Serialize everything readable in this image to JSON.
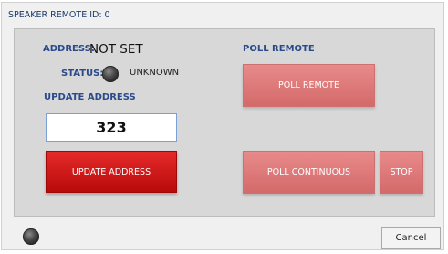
{
  "window": {
    "title": "SPEAKER REMOTE ID: 0"
  },
  "address": {
    "label": "ADDRESS:",
    "value": "NOT SET"
  },
  "status": {
    "label": "STATUS:",
    "value": "UNKNOWN"
  },
  "update": {
    "section_label": "UPDATE ADDRESS",
    "input_value": "323",
    "button_label": "UPDATE ADDRESS"
  },
  "poll": {
    "section_label": "POLL REMOTE",
    "poll_button": "POLL REMOTE",
    "continuous_button": "POLL CONTINUOUS",
    "stop_button": "STOP"
  },
  "footer": {
    "cancel_label": "Cancel"
  },
  "colors": {
    "accent_red": "#cc1515",
    "accent_pink": "#de7a7a",
    "label_blue": "#2a4a8a"
  }
}
